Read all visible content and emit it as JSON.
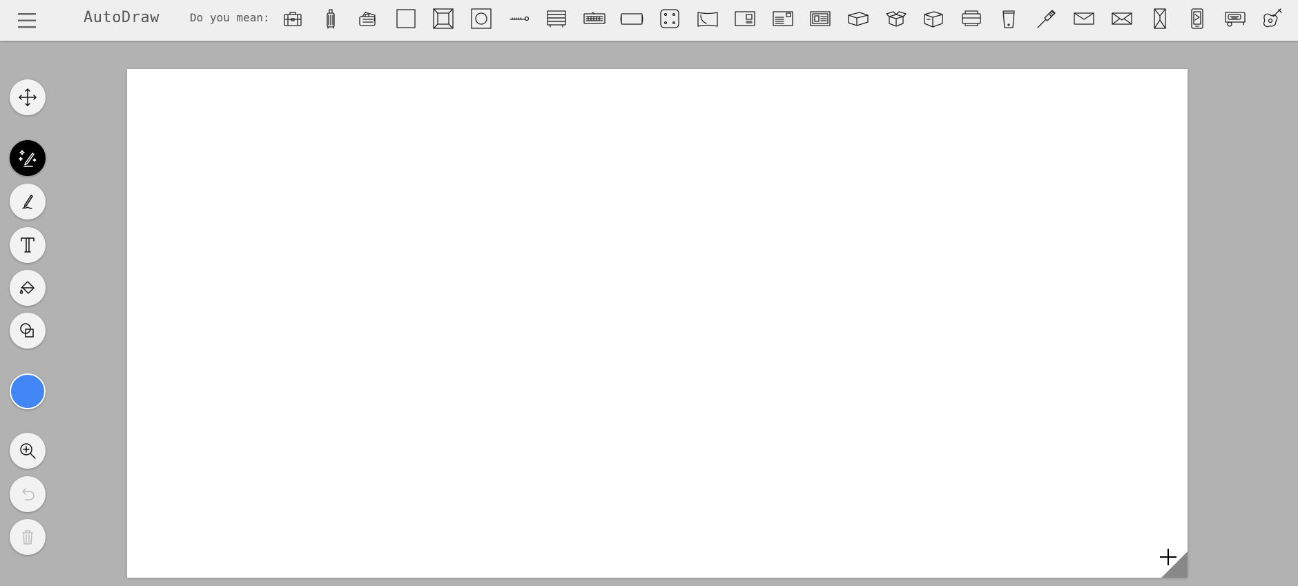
{
  "header": {
    "app_title": "AutoDraw",
    "suggestions_label": "Do you mean:",
    "suggestions": [
      "briefcase-icon",
      "rolling-suitcase-icon",
      "stacked-luggage-icon",
      "square-frame-icon",
      "framed-square-icon",
      "square-circle-icon",
      "key-icon",
      "stacked-books-icon",
      "keyboard-icon",
      "rounded-rectangle-icon",
      "dice-icon",
      "curved-frame-icon",
      "id-card-icon",
      "postcard-icon",
      "business-card-icon",
      "closed-box-icon",
      "open-box-icon",
      "storage-box-icon",
      "printer-icon",
      "phone-stand-icon",
      "paintbrush-icon",
      "envelope-icon",
      "open-envelope-icon",
      "door-icon",
      "phone-case-icon",
      "camper-icon",
      "guitar-icon"
    ]
  },
  "sidebar": {
    "tools": [
      {
        "name": "move-tool-button",
        "icon": "move-arrows-icon",
        "state": "normal"
      },
      {
        "name": "autodraw-tool-button",
        "icon": "magic-pencil-icon",
        "state": "active"
      },
      {
        "name": "draw-tool-button",
        "icon": "pencil-icon",
        "state": "normal"
      },
      {
        "name": "type-tool-button",
        "icon": "text-t-icon",
        "state": "normal"
      },
      {
        "name": "fill-tool-button",
        "icon": "paint-bucket-icon",
        "state": "normal"
      },
      {
        "name": "shape-tool-button",
        "icon": "shapes-icon",
        "state": "normal"
      }
    ],
    "color": "#4285f4",
    "actions": [
      {
        "name": "zoom-button",
        "icon": "zoom-in-icon",
        "state": "normal"
      },
      {
        "name": "undo-button",
        "icon": "undo-icon",
        "state": "disabled"
      },
      {
        "name": "delete-button",
        "icon": "trash-icon",
        "state": "disabled"
      }
    ]
  },
  "colors": {
    "background": "#b2b2b2",
    "topbar": "#efefef",
    "canvas": "#ffffff",
    "accent": "#4285f4"
  }
}
